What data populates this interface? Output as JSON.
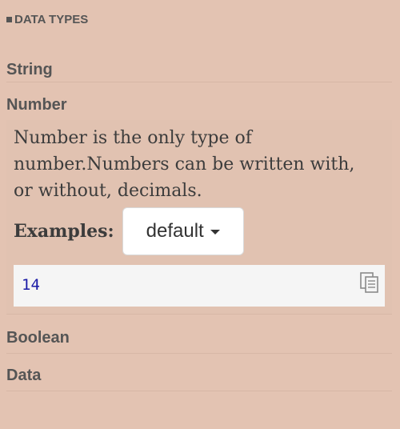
{
  "section": {
    "title": "DATA TYPES"
  },
  "types": [
    {
      "label": "String"
    },
    {
      "label": "Number"
    },
    {
      "label": "Boolean"
    },
    {
      "label": "Data"
    }
  ],
  "number_detail": {
    "description_lines": [
      "Number is the only type of",
      "number.Numbers can be written with,",
      "or without, decimals."
    ],
    "examples_label": "Examples:",
    "examples_select": {
      "selected": "default",
      "icon": "caret-down-icon"
    },
    "code": "14",
    "copy_icon": "copy-icon"
  },
  "colors": {
    "panel_background": "#e3c3b2",
    "code_text": "#1a1aa6",
    "code_background": "#f5f5f5"
  }
}
